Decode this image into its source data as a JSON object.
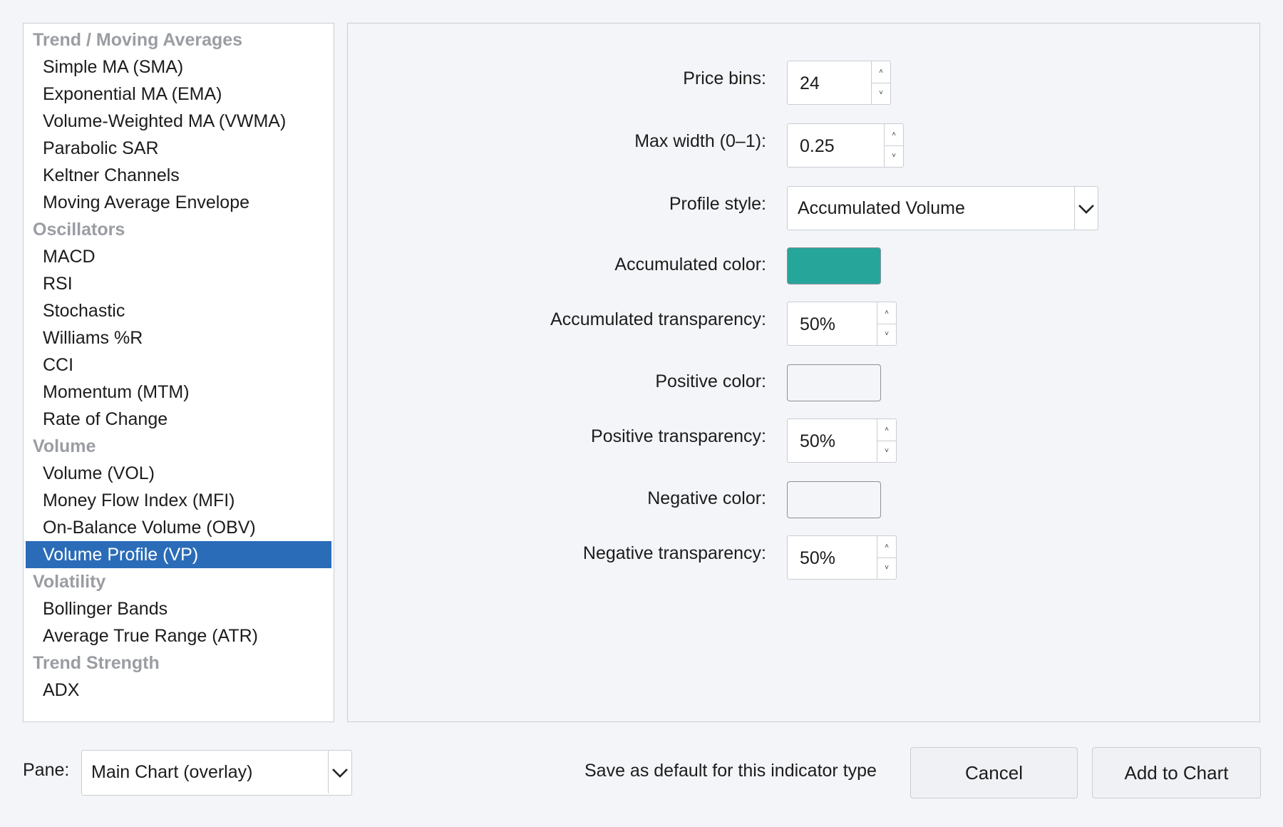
{
  "indicator_list": {
    "rows": [
      {
        "type": "category",
        "label": "Trend / Moving Averages"
      },
      {
        "type": "item",
        "label": "Simple MA (SMA)"
      },
      {
        "type": "item",
        "label": "Exponential MA (EMA)"
      },
      {
        "type": "item",
        "label": "Volume-Weighted MA (VWMA)"
      },
      {
        "type": "item",
        "label": "Parabolic SAR"
      },
      {
        "type": "item",
        "label": "Keltner Channels"
      },
      {
        "type": "item",
        "label": "Moving Average Envelope"
      },
      {
        "type": "category",
        "label": "Oscillators"
      },
      {
        "type": "item",
        "label": "MACD"
      },
      {
        "type": "item",
        "label": "RSI"
      },
      {
        "type": "item",
        "label": "Stochastic"
      },
      {
        "type": "item",
        "label": "Williams %R"
      },
      {
        "type": "item",
        "label": "CCI"
      },
      {
        "type": "item",
        "label": "Momentum (MTM)"
      },
      {
        "type": "item",
        "label": "Rate of Change"
      },
      {
        "type": "category",
        "label": "Volume"
      },
      {
        "type": "item",
        "label": "Volume (VOL)"
      },
      {
        "type": "item",
        "label": "Money Flow Index (MFI)"
      },
      {
        "type": "item",
        "label": "On-Balance Volume (OBV)"
      },
      {
        "type": "item",
        "label": "Volume Profile (VP)",
        "selected": true
      },
      {
        "type": "category",
        "label": "Volatility"
      },
      {
        "type": "item",
        "label": "Bollinger Bands"
      },
      {
        "type": "item",
        "label": "Average True Range (ATR)"
      },
      {
        "type": "category",
        "label": "Trend Strength"
      },
      {
        "type": "item",
        "label": "ADX"
      }
    ]
  },
  "settings": {
    "price_bins": {
      "label": "Price bins:",
      "value": "24"
    },
    "max_width": {
      "label": "Max width (0–1):",
      "value": "0.25"
    },
    "profile_style": {
      "label": "Profile style:",
      "value": "Accumulated Volume"
    },
    "accumulated_color": {
      "label": "Accumulated color:",
      "color": "#26a69a"
    },
    "accumulated_transparency": {
      "label": "Accumulated transparency:",
      "value": "50%"
    },
    "positive_color": {
      "label": "Positive color:",
      "color": "#f3f5f8"
    },
    "positive_transparency": {
      "label": "Positive transparency:",
      "value": "50%"
    },
    "negative_color": {
      "label": "Negative color:",
      "color": "#f3f5f8"
    },
    "negative_transparency": {
      "label": "Negative transparency:",
      "value": "50%"
    }
  },
  "footer": {
    "pane_label": "Pane:",
    "pane_value": "Main Chart (overlay)",
    "save_default_label": "Save as default for this indicator type",
    "cancel_label": "Cancel",
    "add_label": "Add to Chart"
  },
  "colors": {
    "selection": "#2b6cb8",
    "accent_swatch": "#26a69a"
  }
}
